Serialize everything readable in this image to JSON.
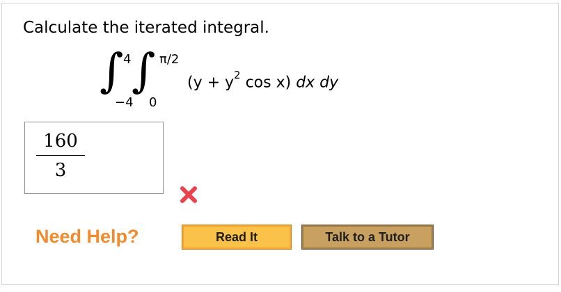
{
  "question": {
    "prompt": "Calculate the iterated integral.",
    "outer_upper": "4",
    "outer_lower": "−4",
    "inner_upper": "π/2",
    "inner_lower": "0",
    "integrand_before_exp": "(y + y",
    "integrand_exp": "2",
    "integrand_after_exp": " cos x) ",
    "differentials": "dx dy"
  },
  "answer": {
    "numerator": "160",
    "denominator": "3",
    "status": "incorrect",
    "status_icon": "x-mark-icon",
    "status_color": "#e8424f"
  },
  "help": {
    "label": "Need Help?",
    "label_color": "#f08c2e",
    "buttons": [
      {
        "label": "Read It",
        "color": "#fbc24a"
      },
      {
        "label": "Talk to a Tutor",
        "color": "#c8a060"
      }
    ]
  }
}
